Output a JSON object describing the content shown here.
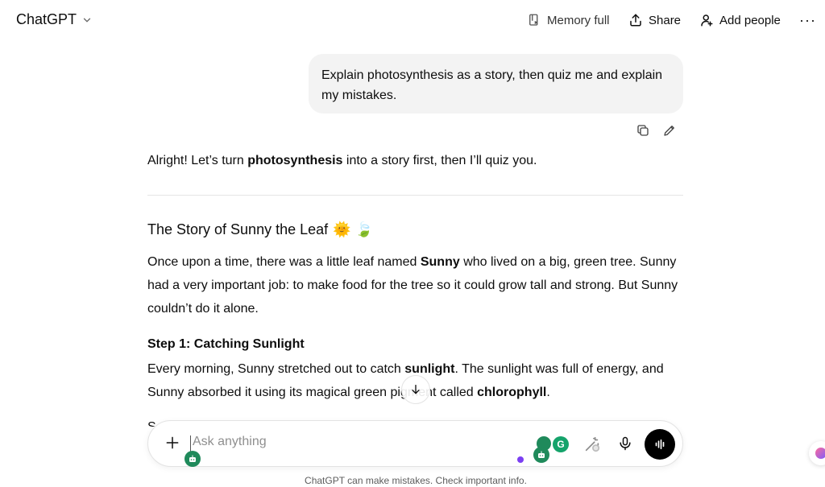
{
  "header": {
    "model": "ChatGPT",
    "memory": "Memory full",
    "share": "Share",
    "add_people": "Add people",
    "more": "···"
  },
  "conversation": {
    "user_message": "Explain photosynthesis as a story, then quiz me and explain my mistakes.",
    "intro_pre": "Alright! Let’s turn ",
    "intro_bold": "photosynthesis",
    "intro_post": " into a story first, then I’ll quiz you.",
    "story_title": "The Story of Sunny the Leaf",
    "story_emoji": "🌞 🍃",
    "p1_a": "Once upon a time, there was a little leaf named ",
    "p1_b": "Sunny",
    "p1_c": " who lived on a big, green tree. Sunny had a very important job: to make food for the tree so it could grow tall and strong. But Sunny couldn’t do it alone.",
    "step1_title": "Step 1: Catching Sunlight",
    "p2_a": "Every morning, Sunny stretched out to catch ",
    "p2_b": "sunlight",
    "p2_c": ". The sunlight was full of energy, and Sunny absorbed it using its magical green pigment called ",
    "p2_d": "chlorophyll",
    "p2_e": ".",
    "cut_glyph": "S"
  },
  "composer": {
    "placeholder": "Ask anything",
    "grammarly": "G"
  },
  "footer": {
    "disclaimer": "ChatGPT can make mistakes. Check important info."
  },
  "colors": {
    "user_bubble": "#f3f3f3",
    "extension_green": "#1f8a5b",
    "accent_purple": "#7b3ff2"
  }
}
